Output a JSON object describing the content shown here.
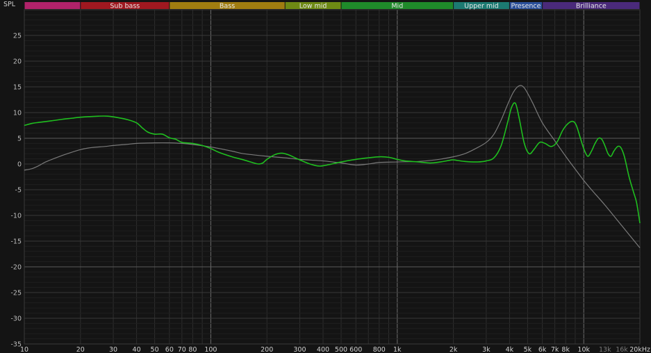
{
  "chart_data": {
    "type": "line",
    "title": "",
    "ylabel": "SPL",
    "xlabel": "",
    "x_scale": "log",
    "xlim": [
      10,
      20000
    ],
    "ylim": [
      -35,
      30
    ],
    "grid": true,
    "bands": [
      {
        "label": "",
        "from": 10,
        "to": 20,
        "color": "#b0226a"
      },
      {
        "label": "Sub bass",
        "from": 20,
        "to": 60,
        "color": "#a01820"
      },
      {
        "label": "Bass",
        "from": 60,
        "to": 250,
        "color": "#a07d10"
      },
      {
        "label": "Low mid",
        "from": 250,
        "to": 500,
        "color": "#6e8a14"
      },
      {
        "label": "Mid",
        "from": 500,
        "to": 2000,
        "color": "#1f8a2a"
      },
      {
        "label": "Upper mid",
        "from": 2000,
        "to": 4000,
        "color": "#1c7a72"
      },
      {
        "label": "Presence",
        "from": 4000,
        "to": 6000,
        "color": "#2a4f9a"
      },
      {
        "label": "Brilliance",
        "from": 6000,
        "to": 20000,
        "color": "#4a2a7a"
      }
    ],
    "y_ticks": [
      25,
      20,
      15,
      10,
      5,
      0,
      -5,
      -10,
      -15,
      -20,
      -25,
      -30,
      -35
    ],
    "x_ticks": [
      {
        "value": 10,
        "label": "10"
      },
      {
        "value": 20,
        "label": "20"
      },
      {
        "value": 30,
        "label": "30"
      },
      {
        "value": 40,
        "label": "40"
      },
      {
        "value": 50,
        "label": "50"
      },
      {
        "value": 60,
        "label": "60"
      },
      {
        "value": 70,
        "label": "70"
      },
      {
        "value": 80,
        "label": "80"
      },
      {
        "value": 100,
        "label": "100"
      },
      {
        "value": 200,
        "label": "200"
      },
      {
        "value": 300,
        "label": "300"
      },
      {
        "value": 400,
        "label": "400"
      },
      {
        "value": 500,
        "label": "500"
      },
      {
        "value": 600,
        "label": "600"
      },
      {
        "value": 800,
        "label": "800"
      },
      {
        "value": 1000,
        "label": "1k"
      },
      {
        "value": 2000,
        "label": "2k"
      },
      {
        "value": 3000,
        "label": "3k"
      },
      {
        "value": 4000,
        "label": "4k"
      },
      {
        "value": 5000,
        "label": "5k"
      },
      {
        "value": 6000,
        "label": "6k"
      },
      {
        "value": 7000,
        "label": "7k"
      },
      {
        "value": 8000,
        "label": "8k"
      },
      {
        "value": 10000,
        "label": "10k"
      },
      {
        "value": 13000,
        "label": "13k",
        "dim": true
      },
      {
        "value": 16000,
        "label": "16k",
        "dim": true
      },
      {
        "value": 20000,
        "label": "20kHz"
      }
    ],
    "series": [
      {
        "name": "",
        "color": "#1fbf1f",
        "points": [
          [
            10,
            7.5
          ],
          [
            11,
            7.9
          ],
          [
            12,
            8.1
          ],
          [
            14,
            8.4
          ],
          [
            16,
            8.7
          ],
          [
            18,
            8.9
          ],
          [
            20,
            9.1
          ],
          [
            25,
            9.3
          ],
          [
            28,
            9.3
          ],
          [
            32,
            9.0
          ],
          [
            36,
            8.6
          ],
          [
            40,
            8.0
          ],
          [
            43,
            7.0
          ],
          [
            46,
            6.2
          ],
          [
            50,
            5.8
          ],
          [
            55,
            5.8
          ],
          [
            60,
            5.1
          ],
          [
            65,
            4.8
          ],
          [
            70,
            4.2
          ],
          [
            80,
            4.0
          ],
          [
            90,
            3.6
          ],
          [
            100,
            3.0
          ],
          [
            110,
            2.3
          ],
          [
            130,
            1.4
          ],
          [
            150,
            0.8
          ],
          [
            170,
            0.2
          ],
          [
            180,
            0.0
          ],
          [
            190,
            0.2
          ],
          [
            200,
            0.9
          ],
          [
            220,
            1.8
          ],
          [
            240,
            2.1
          ],
          [
            260,
            1.8
          ],
          [
            300,
            0.8
          ],
          [
            340,
            0.0
          ],
          [
            380,
            -0.4
          ],
          [
            420,
            -0.2
          ],
          [
            500,
            0.4
          ],
          [
            600,
            0.9
          ],
          [
            700,
            1.2
          ],
          [
            800,
            1.4
          ],
          [
            900,
            1.3
          ],
          [
            1000,
            0.9
          ],
          [
            1100,
            0.6
          ],
          [
            1300,
            0.4
          ],
          [
            1500,
            0.2
          ],
          [
            1700,
            0.4
          ],
          [
            1900,
            0.7
          ],
          [
            2000,
            0.8
          ],
          [
            2300,
            0.5
          ],
          [
            2700,
            0.4
          ],
          [
            3000,
            0.6
          ],
          [
            3300,
            1.2
          ],
          [
            3600,
            3.5
          ],
          [
            3900,
            8.0
          ],
          [
            4100,
            11.0
          ],
          [
            4300,
            11.8
          ],
          [
            4500,
            9.0
          ],
          [
            4800,
            4.0
          ],
          [
            5100,
            2.0
          ],
          [
            5400,
            2.8
          ],
          [
            5800,
            4.2
          ],
          [
            6200,
            4.0
          ],
          [
            6700,
            3.4
          ],
          [
            7200,
            4.3
          ],
          [
            7700,
            6.5
          ],
          [
            8200,
            7.8
          ],
          [
            8700,
            8.3
          ],
          [
            9100,
            7.6
          ],
          [
            9600,
            5.0
          ],
          [
            10000,
            3.0
          ],
          [
            10500,
            1.5
          ],
          [
            11000,
            2.5
          ],
          [
            11500,
            4.0
          ],
          [
            12000,
            5.0
          ],
          [
            12500,
            4.8
          ],
          [
            13000,
            3.5
          ],
          [
            13500,
            2.0
          ],
          [
            14000,
            1.5
          ],
          [
            14500,
            2.5
          ],
          [
            15200,
            3.4
          ],
          [
            15800,
            3.2
          ],
          [
            16500,
            1.5
          ],
          [
            17500,
            -2.5
          ],
          [
            18500,
            -5.5
          ],
          [
            19200,
            -7.5
          ],
          [
            20000,
            -11.5
          ]
        ]
      },
      {
        "name": "",
        "color": "#7a7a7a",
        "points": [
          [
            10,
            -1.2
          ],
          [
            11,
            -0.9
          ],
          [
            12,
            -0.3
          ],
          [
            13,
            0.4
          ],
          [
            15,
            1.3
          ],
          [
            17,
            2.0
          ],
          [
            20,
            2.8
          ],
          [
            23,
            3.2
          ],
          [
            27,
            3.4
          ],
          [
            30,
            3.6
          ],
          [
            35,
            3.8
          ],
          [
            40,
            4.0
          ],
          [
            50,
            4.1
          ],
          [
            60,
            4.1
          ],
          [
            70,
            4.0
          ],
          [
            80,
            3.8
          ],
          [
            100,
            3.3
          ],
          [
            130,
            2.5
          ],
          [
            150,
            2.0
          ],
          [
            200,
            1.5
          ],
          [
            250,
            1.2
          ],
          [
            300,
            0.9
          ],
          [
            400,
            0.6
          ],
          [
            500,
            0.2
          ],
          [
            600,
            -0.2
          ],
          [
            700,
            0.0
          ],
          [
            800,
            0.3
          ],
          [
            1000,
            0.4
          ],
          [
            1300,
            0.5
          ],
          [
            1600,
            0.8
          ],
          [
            2000,
            1.4
          ],
          [
            2300,
            2.0
          ],
          [
            2600,
            2.9
          ],
          [
            3000,
            4.2
          ],
          [
            3300,
            5.8
          ],
          [
            3600,
            8.5
          ],
          [
            3900,
            11.5
          ],
          [
            4200,
            14.0
          ],
          [
            4500,
            15.2
          ],
          [
            4800,
            14.8
          ],
          [
            5300,
            12.0
          ],
          [
            6000,
            8.0
          ],
          [
            7000,
            4.5
          ],
          [
            8000,
            1.5
          ],
          [
            9000,
            -1.0
          ],
          [
            10000,
            -3.2
          ],
          [
            11000,
            -5.0
          ],
          [
            13000,
            -8.0
          ],
          [
            16000,
            -12.0
          ],
          [
            20000,
            -16.3
          ]
        ]
      }
    ]
  }
}
